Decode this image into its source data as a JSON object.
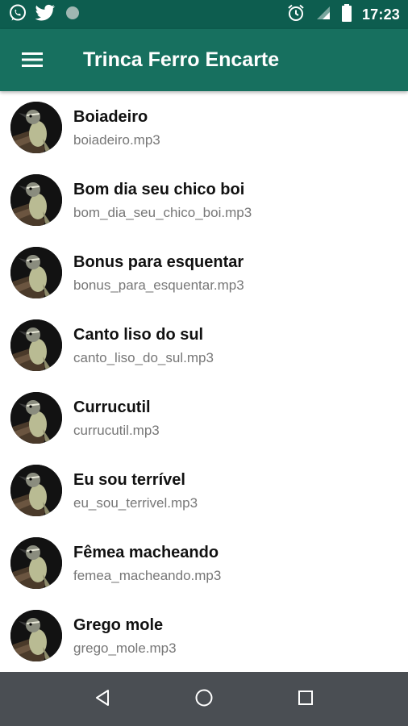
{
  "status_bar": {
    "time": "17:23",
    "left_icons": [
      "whatsapp-icon",
      "twitter-icon",
      "notification-dot-icon"
    ],
    "right_icons": [
      "alarm-icon",
      "signal-icon",
      "battery-icon"
    ]
  },
  "app_bar": {
    "title": "Trinca Ferro Encarte",
    "menu_icon": "hamburger-menu-icon"
  },
  "tracks": [
    {
      "title": "Boiadeiro",
      "file": "boiadeiro.mp3"
    },
    {
      "title": "Bom dia seu chico boi",
      "file": "bom_dia_seu_chico_boi.mp3"
    },
    {
      "title": "Bonus para esquentar",
      "file": "bonus_para_esquentar.mp3"
    },
    {
      "title": "Canto liso do sul",
      "file": "canto_liso_do_sul.mp3"
    },
    {
      "title": "Currucutil",
      "file": "currucutil.mp3"
    },
    {
      "title": "Eu sou terrível",
      "file": "eu_sou_terrivel.mp3"
    },
    {
      "title": "Fêmea macheando",
      "file": "femea_macheando.mp3"
    },
    {
      "title": "Grego mole",
      "file": "grego_mole.mp3"
    }
  ],
  "nav_bar": {
    "icons": [
      "back-icon",
      "home-icon",
      "recents-icon"
    ]
  },
  "colors": {
    "status_bar": "#0d5d4f",
    "app_bar": "#17705f",
    "nav_bar": "#4a4e53"
  }
}
